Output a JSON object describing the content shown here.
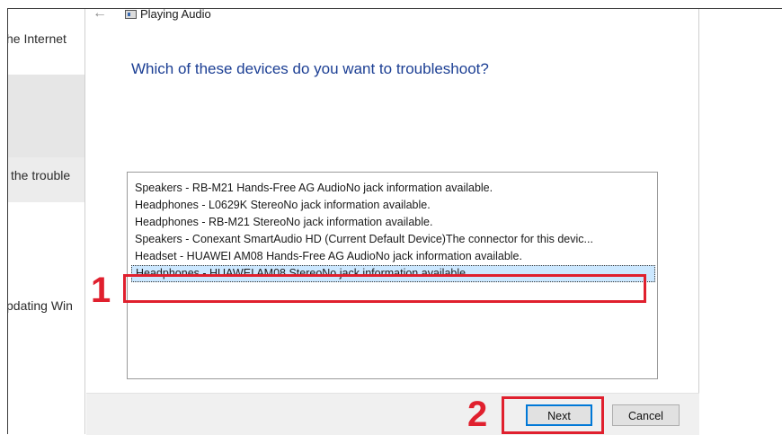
{
  "background": {
    "items": [
      "he Internet",
      "the trouble",
      "pdating Win"
    ]
  },
  "dialog": {
    "title": "Playing Audio",
    "question": "Which of these devices do you want to troubleshoot?",
    "devices": [
      "Speakers - RB-M21 Hands-Free AG AudioNo jack information available.",
      "Headphones - L0629K StereoNo jack information available.",
      "Headphones - RB-M21 StereoNo jack information available.",
      "Speakers - Conexant SmartAudio HD (Current Default Device)The connector for this devic...",
      "Headset - HUAWEI AM08 Hands-Free AG AudioNo jack information available.",
      "Headphones - HUAWEI AM08 StereoNo jack information available."
    ],
    "selected_index": 5,
    "buttons": {
      "next": "Next",
      "cancel": "Cancel"
    }
  },
  "annotations": {
    "step1": "1",
    "step2": "2",
    "color": "#e0202e"
  },
  "colors": {
    "heading": "#1c3f94",
    "selection": "#cce8ff",
    "accent": "#0078d7"
  }
}
